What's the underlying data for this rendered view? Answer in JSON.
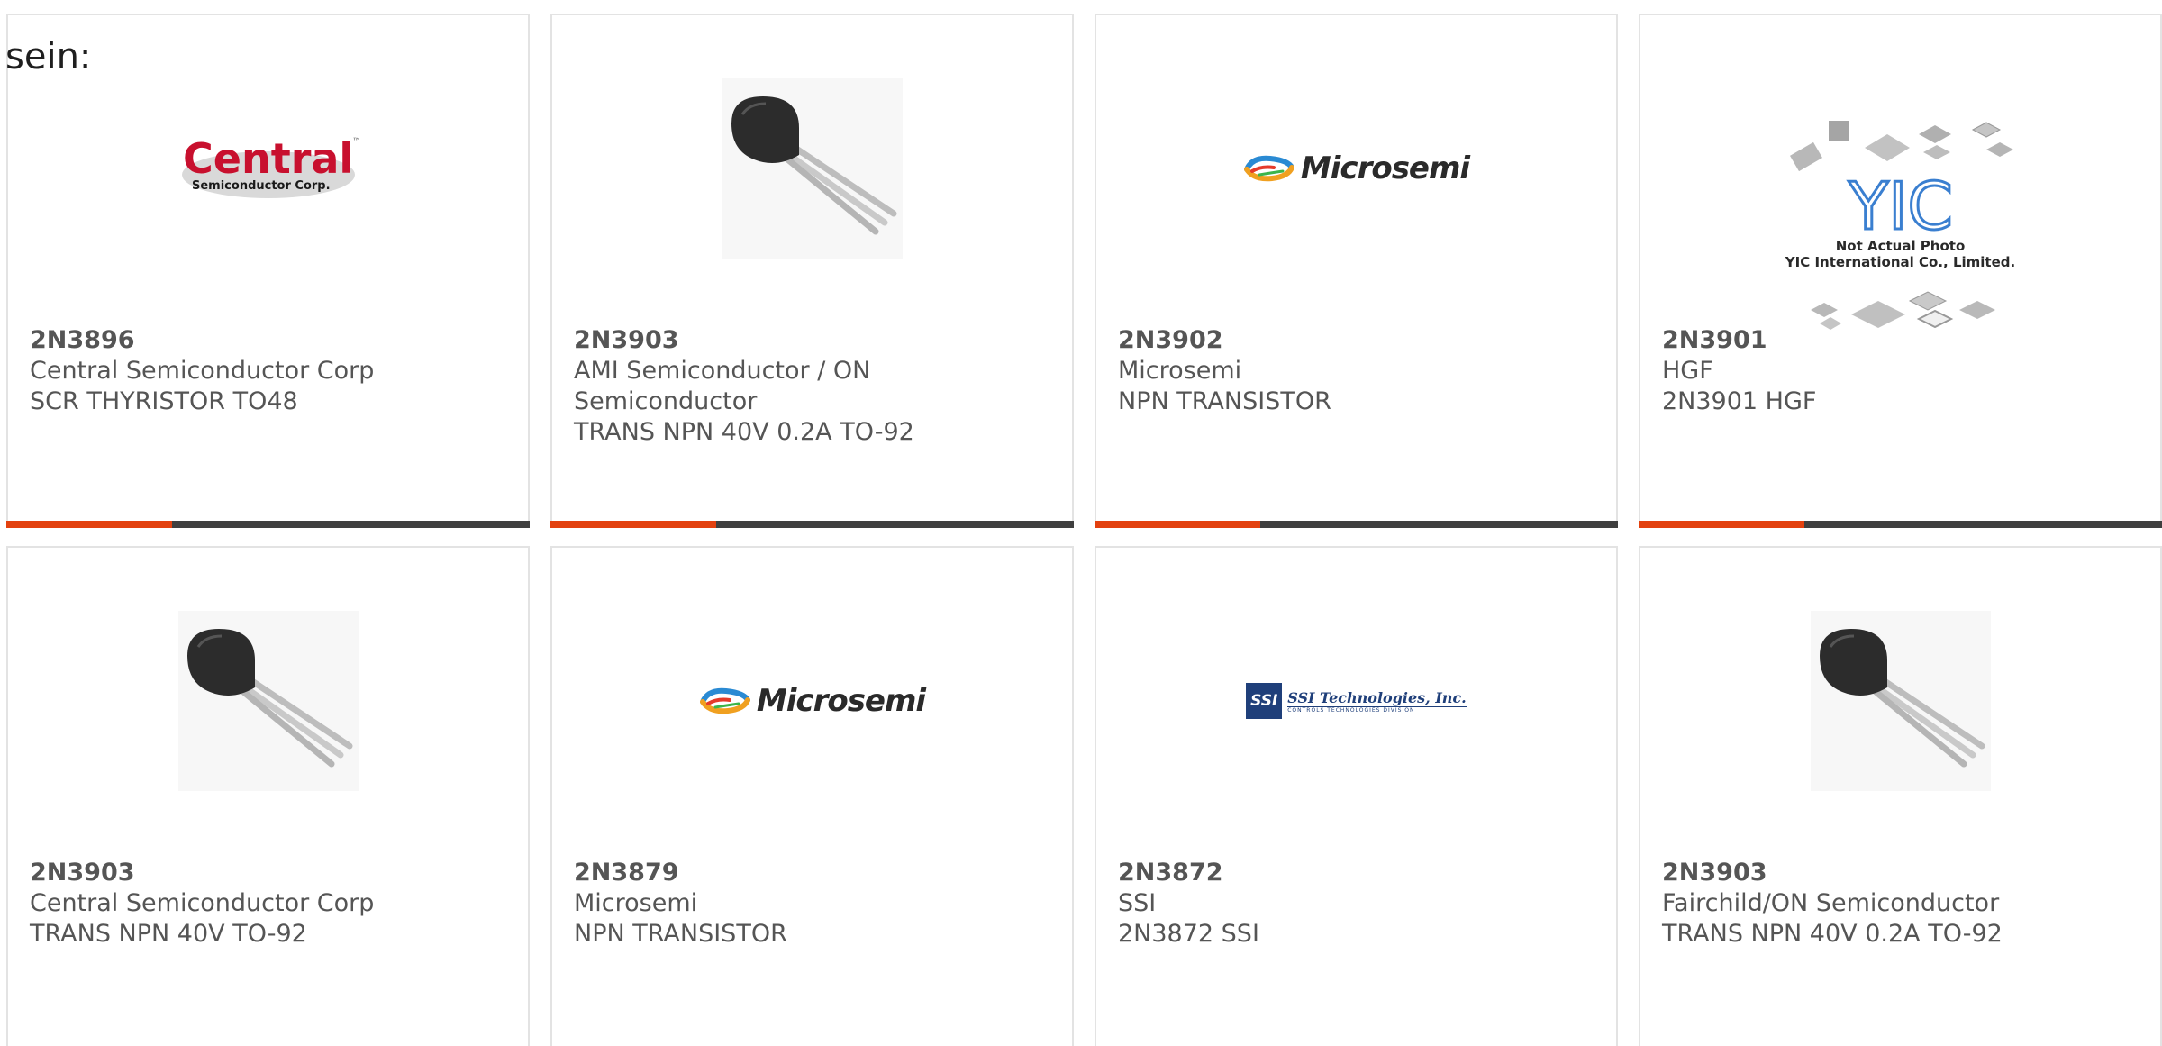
{
  "intro_text": "sein:",
  "colors": {
    "accent_bar": "#e3410f",
    "bar": "#3f3f3f",
    "card_border": "#e3e3e3"
  },
  "products": [
    {
      "part_number": "2N3896",
      "manufacturer": "Central Semiconductor Corp",
      "description": "SCR THYRISTOR TO48",
      "image": "central-semiconductor-logo",
      "logo_text": "Central",
      "logo_subtext": "Semiconductor Corp.",
      "logo_tm": "™"
    },
    {
      "part_number": "2N3903",
      "manufacturer": "AMI Semiconductor / ON Semiconductor",
      "description": "TRANS NPN 40V 0.2A TO-92",
      "image": "to92-transistor-photo"
    },
    {
      "part_number": "2N3902",
      "manufacturer": "Microsemi",
      "description": "NPN TRANSISTOR",
      "image": "microsemi-logo",
      "logo_text": "Microsemi"
    },
    {
      "part_number": "2N3901",
      "manufacturer": "HGF",
      "description": "2N3901 HGF",
      "image": "yic-placeholder",
      "logo_text": "YIC",
      "caption_line1": "Not Actual Photo",
      "caption_line2": "YIC International Co., Limited."
    },
    {
      "part_number": "2N3903",
      "manufacturer": "Central Semiconductor Corp",
      "description": "TRANS NPN 40V TO-92",
      "image": "to92-transistor-photo"
    },
    {
      "part_number": "2N3879",
      "manufacturer": "Microsemi",
      "description": "NPN TRANSISTOR",
      "image": "microsemi-logo",
      "logo_text": "Microsemi"
    },
    {
      "part_number": "2N3872",
      "manufacturer": "SSI",
      "description": "2N3872 SSI",
      "image": "ssi-technologies-logo",
      "logo_box": "SSI",
      "logo_text": "SSI Technologies, Inc.",
      "logo_subtext": "CONTROLS TECHNOLOGIES DIVISION"
    },
    {
      "part_number": "2N3903",
      "manufacturer": "Fairchild/ON Semiconductor",
      "description": "TRANS NPN 40V 0.2A TO-92",
      "image": "to92-transistor-photo"
    }
  ]
}
